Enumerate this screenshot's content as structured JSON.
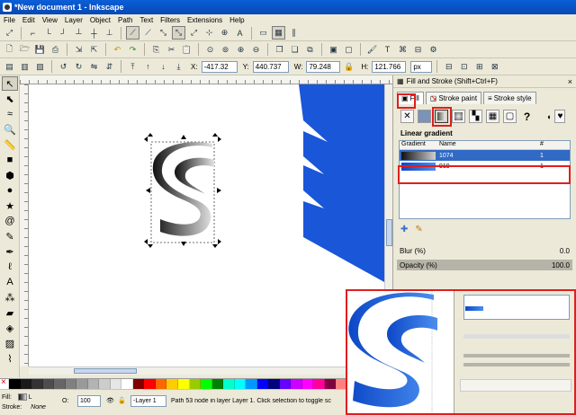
{
  "window": {
    "title": "*New document 1 - Inkscape"
  },
  "menu": [
    "File",
    "Edit",
    "View",
    "Layer",
    "Object",
    "Path",
    "Text",
    "Filters",
    "Extensions",
    "Help"
  ],
  "toolbar_coords": {
    "x_label": "X:",
    "x_value": "-417.32",
    "y_label": "Y:",
    "y_value": "440.737",
    "w_label": "W:",
    "w_value": "79.248",
    "h_label": "H:",
    "h_value": "121.766",
    "unit": "px"
  },
  "dock": {
    "title": "Fill and Stroke (Shift+Ctrl+F)",
    "tabs": [
      "Fill",
      "Stroke paint",
      "Stroke style"
    ],
    "section": "Linear gradient",
    "table_headers": {
      "gradient": "Gradient",
      "name": "Name",
      "count": "#"
    },
    "rows": [
      {
        "name": "1074",
        "count": "1",
        "colors": [
          "#111111",
          "#d0d0d0"
        ],
        "selected": true
      },
      {
        "name": "919",
        "count": "1",
        "colors": [
          "#0d47c7",
          "#4a8ef0"
        ],
        "selected": false
      }
    ],
    "blur_label": "Blur (%)",
    "blur_value": "0.0",
    "opacity_label": "Opacity (%)",
    "opacity_value": "100.0"
  },
  "status": {
    "fill_label": "Fill:",
    "fill_value": "L",
    "stroke_label": "Stroke:",
    "stroke_value": "None",
    "opacity_label": "O:",
    "opacity_value": "100",
    "layer": "-Layer 1",
    "message": "Path 53 node in layer Layer 1. Click selection to toggle sc"
  },
  "colors": {
    "accent_red": "#e01e1e",
    "shape_blue": "#1a56d8",
    "selection_blue": "#316ac5"
  },
  "icons": [
    "selector-icon",
    "node-icon",
    "zoom-icon",
    "rect-icon",
    "circle-icon",
    "star-icon",
    "spiral-icon",
    "pencil-icon",
    "pen-icon",
    "calligraphy-icon",
    "text-icon",
    "gradient-icon",
    "dropper-icon",
    "paint-bucket-icon",
    "eraser-icon"
  ]
}
